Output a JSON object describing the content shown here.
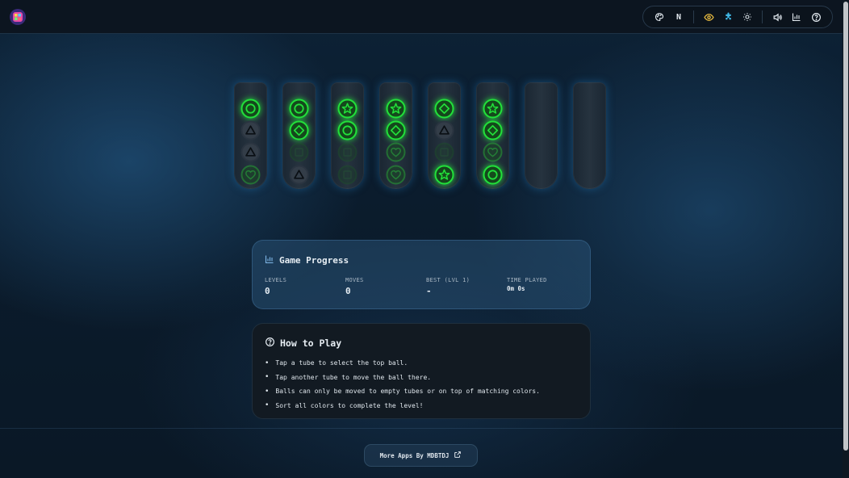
{
  "header": {
    "logo_icon": "puzzle-logo-icon",
    "toolbar": [
      {
        "name": "palette",
        "icon": "palette-icon"
      },
      {
        "name": "mode",
        "label": "N"
      },
      {
        "name": "visibility",
        "icon": "eye-icon",
        "color": "#f5c542"
      },
      {
        "name": "puzzle",
        "icon": "puzzle-piece-icon",
        "color": "#3fb7e6"
      },
      {
        "name": "brightness",
        "icon": "sun-icon"
      },
      {
        "name": "sound",
        "icon": "volume-icon"
      },
      {
        "name": "stats",
        "icon": "bar-chart-icon"
      },
      {
        "name": "help",
        "icon": "help-circle-icon"
      }
    ]
  },
  "game": {
    "ball_color": "#22e03a",
    "tubes": [
      {
        "balls": [
          {
            "shape": "circle",
            "state": "active"
          },
          {
            "shape": "triangle",
            "state": "dark"
          },
          {
            "shape": "triangle",
            "state": "dark"
          },
          {
            "shape": "heart",
            "state": "dim"
          }
        ]
      },
      {
        "balls": [
          {
            "shape": "circle",
            "state": "active"
          },
          {
            "shape": "diamond",
            "state": "active"
          },
          {
            "shape": "square",
            "state": "empty"
          },
          {
            "shape": "triangle",
            "state": "dark"
          }
        ]
      },
      {
        "balls": [
          {
            "shape": "star",
            "state": "active"
          },
          {
            "shape": "circle",
            "state": "active"
          },
          {
            "shape": "square",
            "state": "empty"
          },
          {
            "shape": "square",
            "state": "empty"
          }
        ]
      },
      {
        "balls": [
          {
            "shape": "star",
            "state": "active"
          },
          {
            "shape": "diamond",
            "state": "active"
          },
          {
            "shape": "heart",
            "state": "dim"
          },
          {
            "shape": "heart",
            "state": "dim"
          }
        ]
      },
      {
        "balls": [
          {
            "shape": "diamond",
            "state": "active"
          },
          {
            "shape": "triangle",
            "state": "dark"
          },
          {
            "shape": "square",
            "state": "empty"
          },
          {
            "shape": "star",
            "state": "active"
          }
        ]
      },
      {
        "balls": [
          {
            "shape": "star",
            "state": "active"
          },
          {
            "shape": "diamond",
            "state": "active"
          },
          {
            "shape": "heart",
            "state": "dim"
          },
          {
            "shape": "circle",
            "state": "active"
          }
        ]
      },
      {
        "balls": []
      },
      {
        "balls": []
      }
    ]
  },
  "progress": {
    "title": "Game Progress",
    "icon": "bar-chart-icon",
    "stats": [
      {
        "label": "LEVELS",
        "value": "0"
      },
      {
        "label": "MOVES",
        "value": "0"
      },
      {
        "label": "BEST (LVL 1)",
        "value": "-"
      },
      {
        "label": "TIME PLAYED",
        "value": "0m 0s"
      }
    ]
  },
  "howto": {
    "title": "How to Play",
    "icon": "help-circle-icon",
    "steps": [
      "Tap a tube to select the top ball.",
      "Tap another tube to move the ball there.",
      "Balls can only be moved to empty tubes or on top of matching colors.",
      "Sort all colors to complete the level!"
    ]
  },
  "footer": {
    "more_apps_label": "More Apps By MDBTDJ",
    "more_apps_icon": "external-link-icon"
  }
}
